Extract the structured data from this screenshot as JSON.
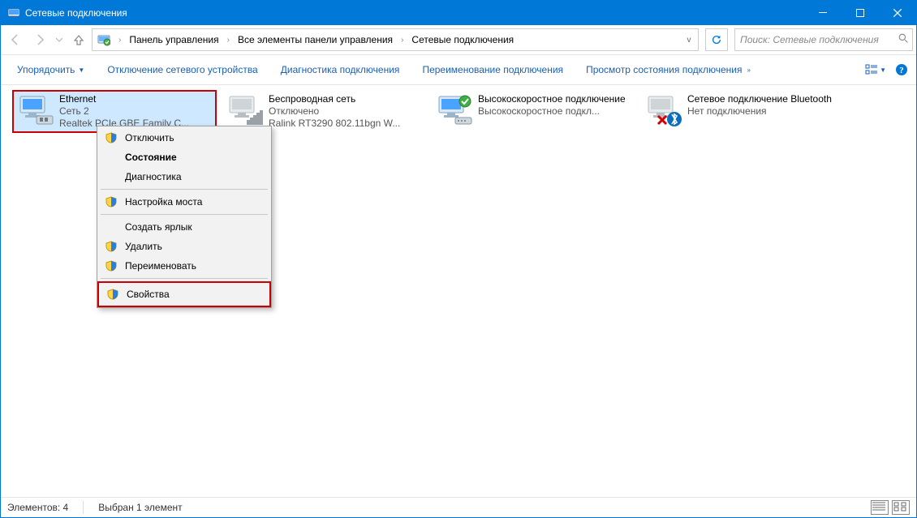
{
  "window": {
    "title": "Сетевые подключения"
  },
  "breadcrumb": {
    "root": "Панель управления",
    "mid": "Все элементы панели управления",
    "leaf": "Сетевые подключения"
  },
  "search": {
    "placeholder": "Поиск: Сетевые подключения"
  },
  "commands": {
    "organize": "Упорядочить",
    "disable": "Отключение сетевого устройства",
    "diagnose": "Диагностика подключения",
    "rename": "Переименование подключения",
    "status": "Просмотр состояния подключения"
  },
  "connections": [
    {
      "name": "Ethernet",
      "status": "Сеть  2",
      "device": "Realtek PCIe GBE Family C..."
    },
    {
      "name": "Беспроводная сеть",
      "status": "Отключено",
      "device": "Ralink RT3290 802.11bgn W..."
    },
    {
      "name": "Высокоскоростное подключение",
      "status": "Высокоскоростное подкл...",
      "device": ""
    },
    {
      "name": "Сетевое подключение Bluetooth",
      "status": "Нет подключения",
      "device": ""
    }
  ],
  "context_menu": {
    "disable": "Отключить",
    "status": "Состояние",
    "diagnose": "Диагностика",
    "bridge": "Настройка моста",
    "shortcut": "Создать ярлык",
    "delete": "Удалить",
    "rename": "Переименовать",
    "properties": "Свойства"
  },
  "statusbar": {
    "count": "Элементов: 4",
    "selection": "Выбран 1 элемент"
  }
}
